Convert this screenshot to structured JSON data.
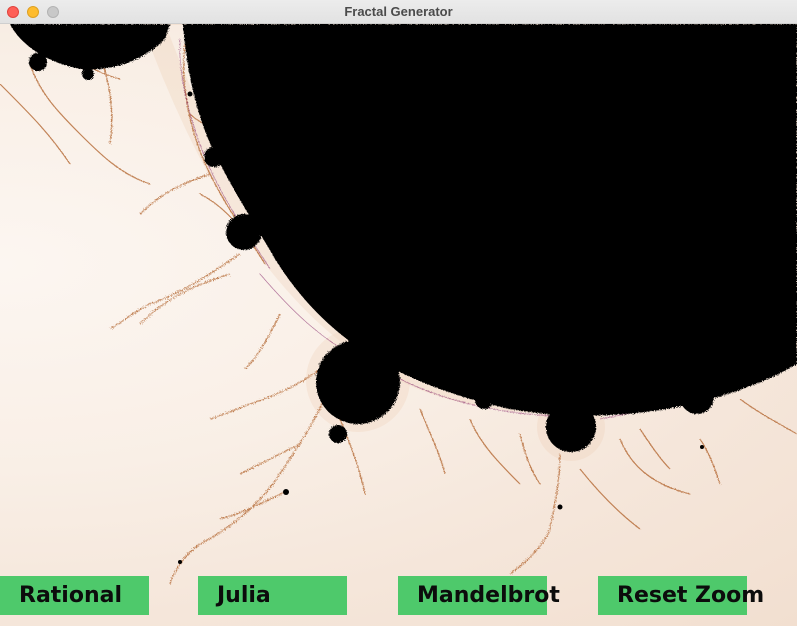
{
  "window": {
    "title": "Fractal Generator"
  },
  "buttons": {
    "rational": "Rational",
    "julia": "Julia",
    "mandelbrot": "Mandelbrot",
    "reset_zoom": "Reset Zoom"
  },
  "colors": {
    "button_bg": "#4ec96b",
    "fractal_set": "#000000",
    "background_light": "#fcf6f1",
    "filament": "#c87a45"
  }
}
